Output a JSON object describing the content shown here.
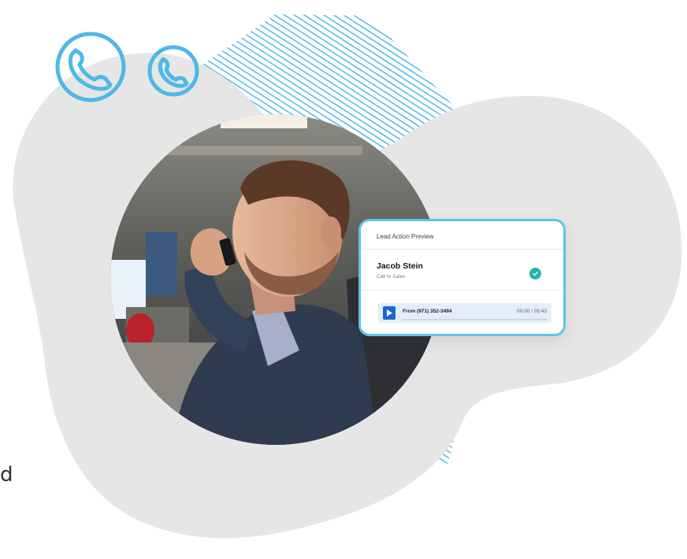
{
  "stray_text": "d",
  "card": {
    "title": "Lead Action Preview",
    "contact_name": "Jacob Stein",
    "contact_sub": "Call to Sales",
    "status_icon": "check-circle-icon",
    "player": {
      "from": "From (971) 352-3494",
      "time": "00:00 / 05:43",
      "progress": 0.0,
      "play_icon": "play-icon"
    }
  },
  "decorations": {
    "phone_icons": [
      "phone-icon",
      "phone-icon"
    ],
    "accent_color": "#4fb8e6",
    "blob_color": "#e6e6e6",
    "check_color": "#28b3ad",
    "play_color": "#1b66d2"
  }
}
